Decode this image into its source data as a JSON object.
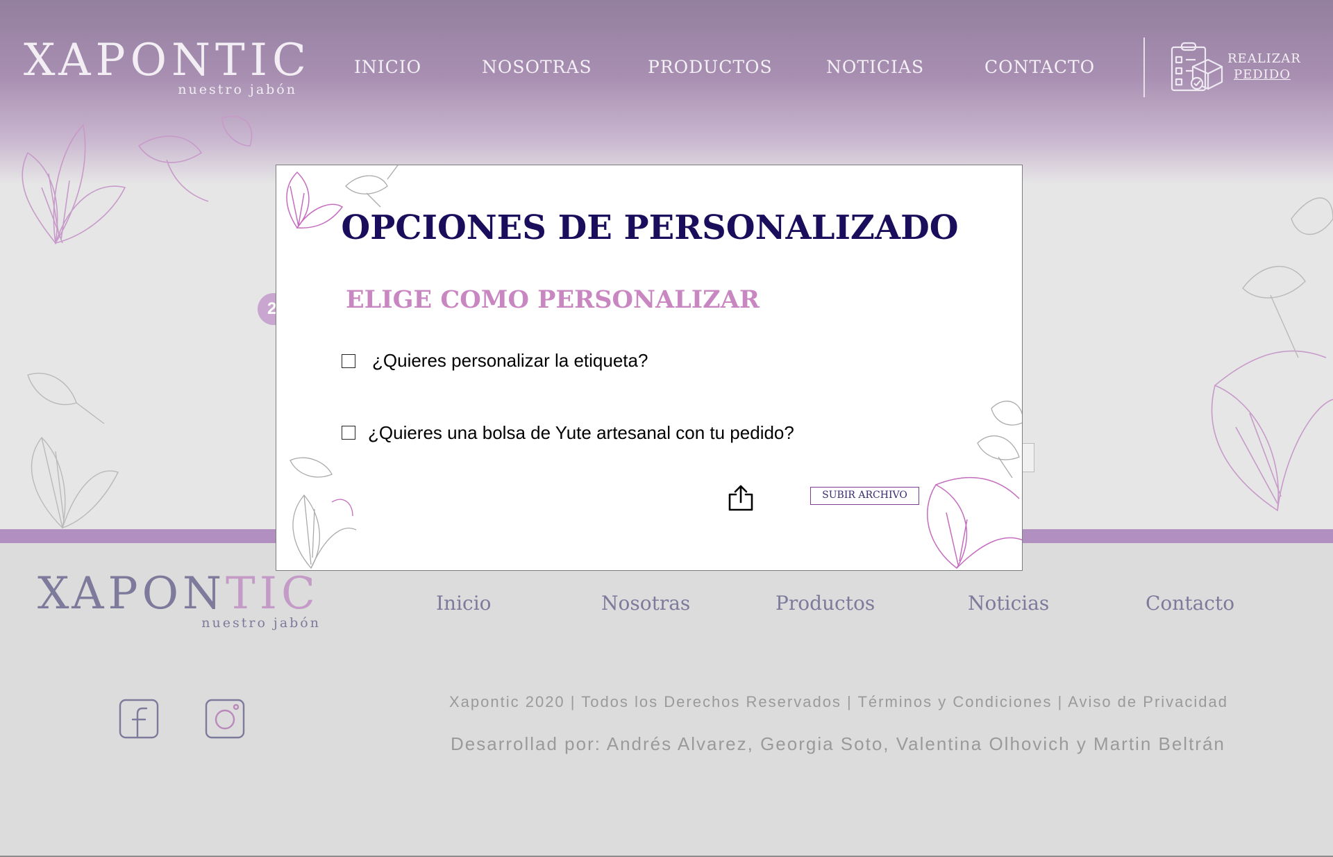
{
  "header": {
    "logo_text": "XAPONTIC",
    "logo_tagline": "nuestro jabón",
    "nav": [
      "INICIO",
      "NOSOTRAS",
      "PRODUCTOS",
      "NOTICIAS",
      "CONTACTO"
    ],
    "order_line1": "REALIZAR",
    "order_line2": "PEDIDO"
  },
  "background": {
    "step_badge": "2"
  },
  "modal": {
    "title": "OPCIONES DE PERSONALIZADO",
    "subtitle": "ELIGE COMO PERSONALIZAR",
    "options": [
      {
        "label": "¿Quieres personalizar la etiqueta?",
        "checked": false
      },
      {
        "label": "¿Quieres una bolsa de Yute artesanal con tu pedido?",
        "checked": false
      }
    ],
    "upload_button": "SUBIR ARCHIVO"
  },
  "footer": {
    "logo_part1": "XAPON",
    "logo_part2": "TIC",
    "logo_tagline": "nuestro jabón",
    "nav": [
      "Inicio",
      "Nosotras",
      "Productos",
      "Noticias",
      "Contacto"
    ],
    "copyright": "Xapontic 2020 | Todos los Derechos Reservados | Términos y Condiciones | Aviso de Privacidad",
    "credits": "Desarrollad por: Andrés Alvarez, Georgia Soto, Valentina Olhovich y Martin Beltrán"
  },
  "colors": {
    "header_purple": "#937f9e",
    "band_purple": "#b18fc1",
    "title_navy": "#1a0d5c",
    "subtitle_pink": "#c987c2",
    "footer_text": "#7d7a9b"
  },
  "icons": [
    "order-clipboard-icon",
    "upload-share-icon",
    "facebook-icon",
    "instagram-icon"
  ]
}
